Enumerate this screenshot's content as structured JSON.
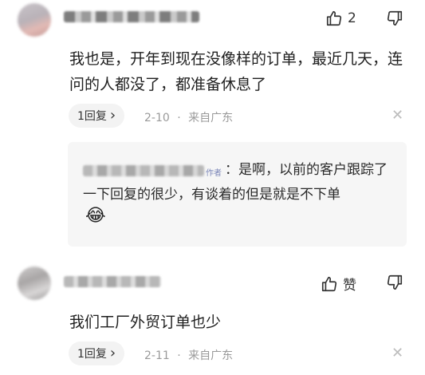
{
  "comments": [
    {
      "like_count": "2",
      "body": "我也是，开年到现在没像样的订单，最近几天，连问的人都没了，都准备休息了",
      "reply_label": "1回复",
      "date": "2-10",
      "location": "来自广东",
      "quote": {
        "author_tag": "作者",
        "separator": "：",
        "text": "是啊，以前的客户跟踪了一下回复的很少，有谈着的但是就是不下单",
        "emoji": "😂"
      }
    },
    {
      "like_label": "赞",
      "body": "我们工厂外贸订单也少",
      "reply_label": "1回复",
      "date": "2-11",
      "location": "来自广东"
    }
  ],
  "icons": {
    "like": "thumbs-up-icon",
    "dislike": "thumbs-down-icon",
    "chevron": "chevron-right-icon",
    "close": "close-icon"
  },
  "separator_dot": "·",
  "close_glyph": "✕",
  "chevron_glyph": "›"
}
